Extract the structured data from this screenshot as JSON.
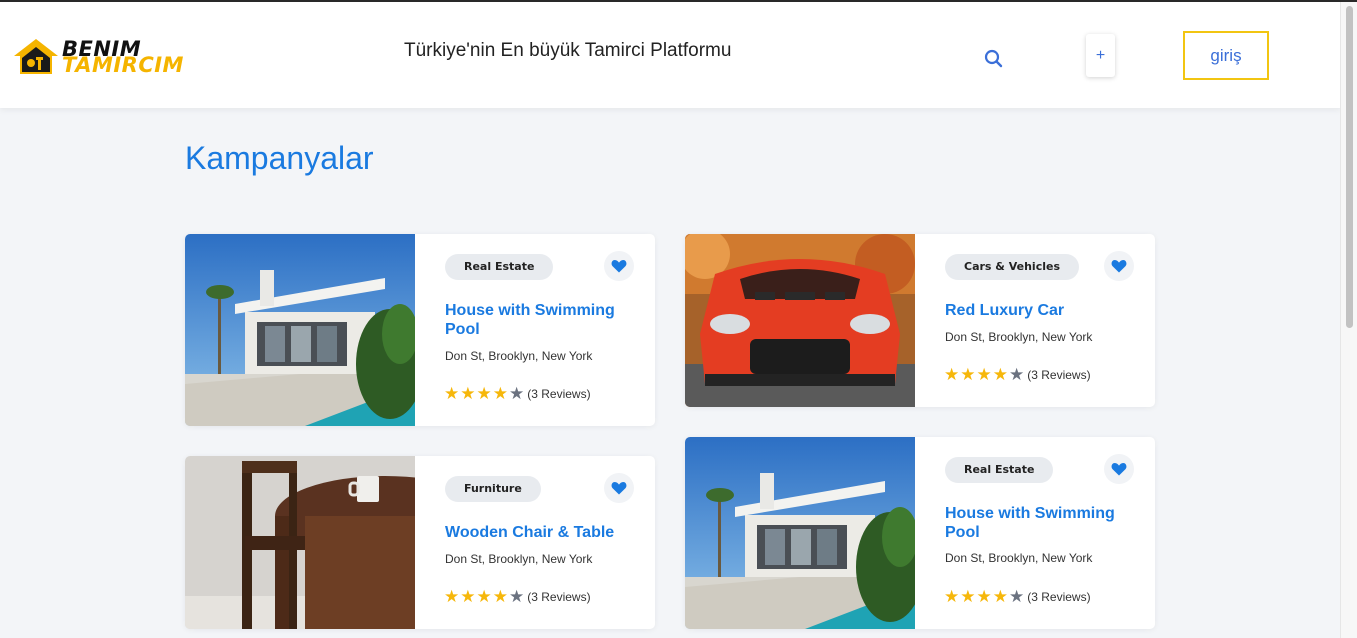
{
  "header": {
    "logo_line1": "BENIM",
    "logo_line2": "TAMIRCIM",
    "tagline": "Türkiye'nin En büyük Tamirci Platformu",
    "plus_label": "+",
    "login_label": "giriş"
  },
  "main": {
    "section_title": "Kampanyalar",
    "cards": [
      {
        "category": "Real Estate",
        "title": "House with Swimming Pool",
        "address": "Don St, Brooklyn, New York",
        "rating": 4,
        "rating_max": 5,
        "reviews": "(3 Reviews)",
        "image": "house-photo"
      },
      {
        "category": "Cars & Vehicles",
        "title": "Red Luxury Car",
        "address": "Don St, Brooklyn, New York",
        "rating": 4,
        "rating_max": 5,
        "reviews": "(3 Reviews)",
        "image": "car-photo"
      },
      {
        "category": "Furniture",
        "title": "Wooden Chair & Table",
        "address": "Don St, Brooklyn, New York",
        "rating": 4,
        "rating_max": 5,
        "reviews": "(3 Reviews)",
        "image": "chair-table-photo"
      },
      {
        "category": "Real Estate",
        "title": "House with Swimming Pool",
        "address": "Don St, Brooklyn, New York",
        "rating": 4,
        "rating_max": 5,
        "reviews": "(3 Reviews)",
        "image": "house-photo"
      }
    ]
  },
  "colors": {
    "accent_blue": "#1a7ae0",
    "star_yellow": "#f6b70b",
    "login_border": "#f2c511"
  }
}
